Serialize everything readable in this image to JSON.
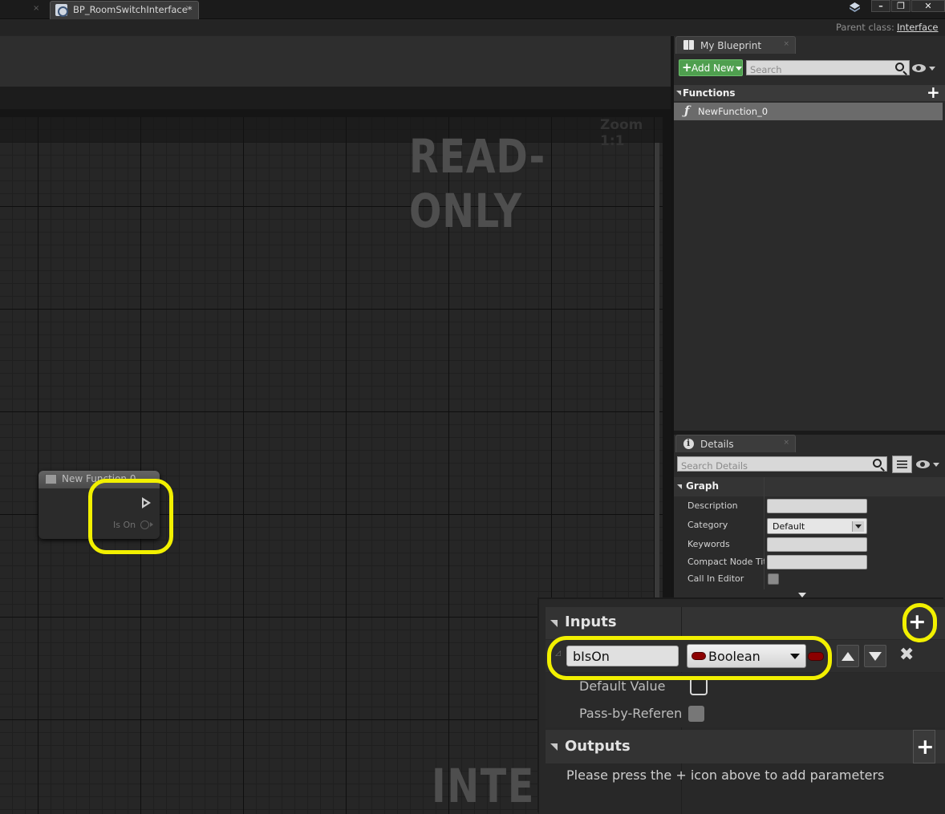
{
  "titlebar": {
    "tab_title": "BP_RoomSwitchInterface*",
    "tab_close_glyph": "×",
    "prev_tab_close_glyph": "×",
    "window_controls": [
      "–",
      "❐",
      "✕"
    ]
  },
  "parent_class": {
    "label": "Parent class:",
    "value": "Interface"
  },
  "graph": {
    "zoom_text": "Zoom 1:1",
    "readonly_watermark": "READ-ONLY",
    "interface_watermark": "INTERFACE",
    "node": {
      "title": "New Function 0",
      "pin_label": "Is On"
    }
  },
  "my_blueprint": {
    "tab_label": "My Blueprint",
    "tab_close": "×",
    "add_new_label": "Add New",
    "search_placeholder": "Search",
    "functions_label": "Functions",
    "function_items": [
      {
        "icon": "ƒ",
        "label": "NewFunction_0"
      }
    ]
  },
  "details": {
    "tab_label": "Details",
    "tab_close": "×",
    "search_placeholder": "Search Details",
    "section_label": "Graph",
    "properties": [
      {
        "label": "Description",
        "kind": "text",
        "value": ""
      },
      {
        "label": "Category",
        "kind": "select",
        "value": "Default"
      },
      {
        "label": "Keywords",
        "kind": "text",
        "value": ""
      },
      {
        "label": "Compact Node Title",
        "kind": "text",
        "value": ""
      },
      {
        "label": "Call In Editor",
        "kind": "checkbox",
        "value": ""
      }
    ]
  },
  "inputs_panel": {
    "inputs_label": "Inputs",
    "param_name": "bIsOn",
    "param_type": "Boolean",
    "default_value_label": "Default Value",
    "pass_by_ref_label": "Pass-by-Reference",
    "remove_glyph": "✖",
    "outputs_label": "Outputs",
    "outputs_hint": "Please press the + icon above to add parameters",
    "plus_glyph": "+"
  },
  "colors": {
    "highlight": "#f2f000",
    "add_new_green": "#4f9f4f",
    "boolean_pin": "#8c0000"
  }
}
